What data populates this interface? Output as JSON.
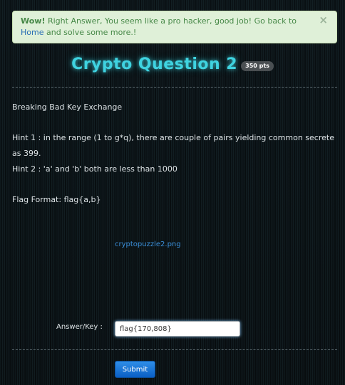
{
  "alert": {
    "strong": "Wow!",
    "text_before_link": " Right Answer, You seem like a pro hacker, good job! Go back to ",
    "link": "Home",
    "text_after_link": " and solve some more.!",
    "close_glyph": "×"
  },
  "challenge": {
    "title": "Crypto Question 2",
    "points": "350 pts",
    "description": "Breaking Bad Key Exchange",
    "hint1": "Hint 1 : in the range (1 to g*q), there are couple of pairs yielding common secrete as 399.",
    "hint2": "Hint 2 : 'a' and 'b' both are less than 1000",
    "flag_format": "Flag Format: flag{a,b}",
    "image_link": "cryptopuzzle2.png"
  },
  "form": {
    "answer_label": "Answer/Key :",
    "answer_value": "flag{170,808}",
    "submit_label": "Submit"
  },
  "colors": {
    "accent": "#3fd3e0",
    "success_bg": "#dff0d8",
    "success_text": "#468847",
    "button": "#0a5fc5"
  }
}
